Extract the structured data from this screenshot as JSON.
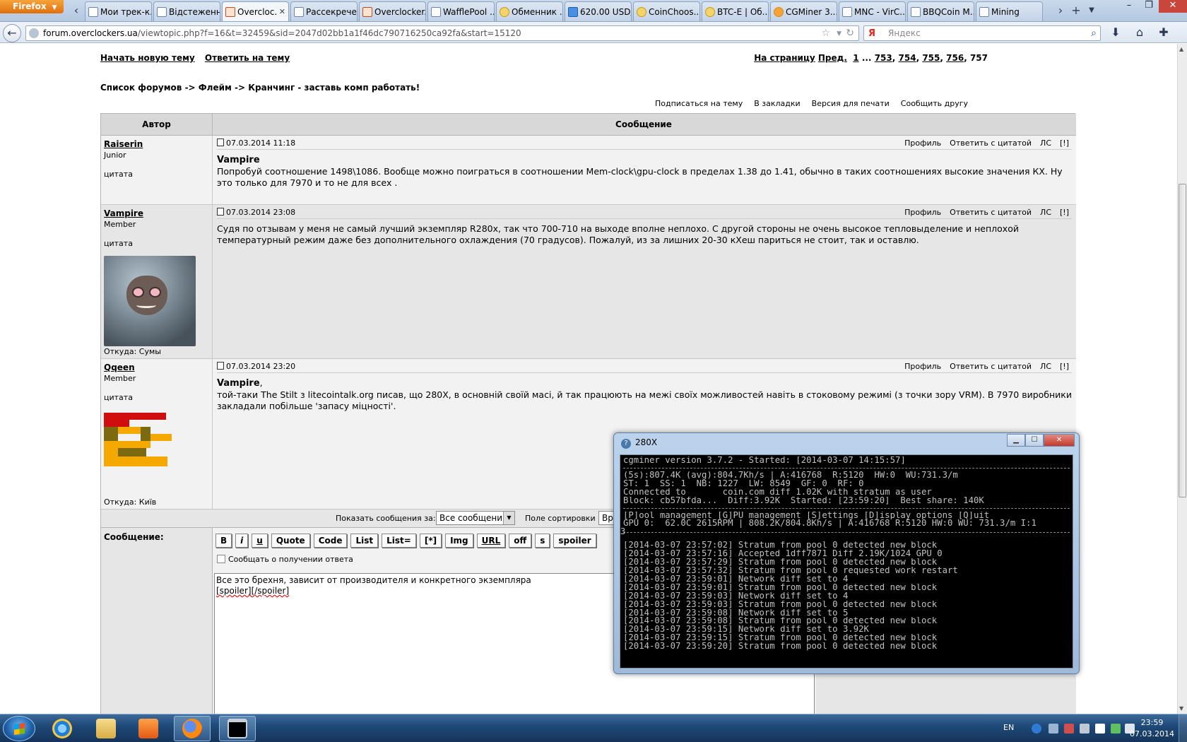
{
  "browser": {
    "menu_button": "Firefox",
    "tabs": [
      {
        "label": "Мои трек-к...",
        "icon": "generic"
      },
      {
        "label": "Відстеженн...",
        "icon": "generic"
      },
      {
        "label": "Overcloc...",
        "icon": "overclockers",
        "active": true
      },
      {
        "label": "Рассекрече...",
        "icon": "generic"
      },
      {
        "label": "Overclocker...",
        "icon": "overclockers"
      },
      {
        "label": "WafflePool ...",
        "icon": "generic"
      },
      {
        "label": "Обменник ...",
        "icon": "coin"
      },
      {
        "label": "620.00 USD/...",
        "icon": "cube"
      },
      {
        "label": "CoinChoos...",
        "icon": "coin"
      },
      {
        "label": "BTC-E | Об...",
        "icon": "coin"
      },
      {
        "label": "CGMiner 3....",
        "icon": "bitcoin"
      },
      {
        "label": "MNC - VirC...",
        "icon": "generic"
      },
      {
        "label": "BBQCoin M...",
        "icon": "generic"
      },
      {
        "label": "Mining",
        "icon": "generic"
      }
    ],
    "url_host": "forum.overclockers.ua",
    "url_prefix": "",
    "url_path": "/viewtopic.php?f=16&t=32459&sid=2047d02bb1a1f46dc790716250ca92fa&start=15120",
    "search_engine_glyph": "Я",
    "search_placeholder": "Яндекс"
  },
  "forum": {
    "new_topic": "Начать новую тему",
    "reply_topic": "Ответить на тему",
    "pagination": {
      "label": "На страницу",
      "prev": "Пред.",
      "first": "1",
      "ellipsis": "...",
      "pages": [
        "753",
        "754",
        "755",
        "756"
      ],
      "current": "757"
    },
    "breadcrumb": "Список форумов -> Флейм -> Кранчинг - заставь комп работать!",
    "top_links": [
      "Подписаться на тему",
      "В закладки",
      "Версия для печати",
      "Сообщить другу"
    ],
    "col_author": "Автор",
    "col_message": "Сообщение",
    "post_actions": [
      "Профиль",
      "Ответить с цитатой",
      "ЛС",
      "[!]"
    ],
    "posts": [
      {
        "author": "Raiserin",
        "rank": "Junior",
        "quote_label": "цитата",
        "date": "07.03.2014 11:18",
        "addressee": "Vampire",
        "text": "Попробуй соотношение 1498\\1086. Вообще можно поиграться в соотношении Mem-clock\\gpu-clock в пределах 1.38 до 1.41, обычно в таких соотношениях высокие значения КХ. Ну это только для 7970 и то не для всех ."
      },
      {
        "author": "Vampire",
        "rank": "Member",
        "quote_label": "цитата",
        "from": "Откуда: Сумы",
        "date": "07.03.2014 23:08",
        "text": "Судя по отзывам у меня не самый лучший экземпляр R280x, так что 700-710 на выходе вполне неплохо. С другой стороны не очень высокое тепловыделение и неплохой температурный режим даже без дополнительного охлаждения (70 градусов). Пожалуй, из за лишних 20-30 кХеш париться не стоит, так и оставлю."
      },
      {
        "author": "Qqeen",
        "rank": "Member",
        "quote_label": "цитата",
        "from": "Откуда: Київ",
        "date": "07.03.2014 23:20",
        "addressee": "Vampire",
        "addressee_suffix": ",",
        "text": "той-таки The Stilt з litecointalk.org писав, що 280X, в основній своїй масі, й так працюють на межі своїх можливостей навіть в стоковому режимі (з точки зору VRM). В 7970 виробники закладали побільше 'запасу міцності'."
      }
    ],
    "sort_bar": {
      "show_label": "Показать сообщения за:",
      "show_value": "Все сообщения",
      "sort_label": "Поле сортировки",
      "sort_value": "Вре"
    },
    "reply": {
      "label": "Сообщение:",
      "buttons": [
        "B",
        "i",
        "u",
        "Quote",
        "Code",
        "List",
        "List=",
        "[*]",
        "Img",
        "URL",
        "off",
        "s",
        "spoiler"
      ],
      "notify_label": "Сообщать о получении ответа",
      "line1": "Все это брехня, зависит от производителя и конкретного экземпляра",
      "line2_open": "[spoiler]",
      "line2_close": "[/spoiler]"
    }
  },
  "cgminer_window": {
    "title": "280X",
    "header": "cgminer version 3.7.2 - Started: [2014-03-07 14:15:57]",
    "stats": [
      "(5s):807.4K (avg):804.7Kh/s | A:416768  R:5120  HW:0  WU:731.3/m",
      "ST: 1  SS: 1  NB: 1227  LW: 8549  GF: 0  RF: 0",
      "Connected to       coin.com diff 1.02K with stratum as user",
      "Block: cb57bfda...  Diff:3.92K  Started: [23:59:20]  Best share: 140K"
    ],
    "menu": "[P]ool management [G]PU management [S]ettings [D]isplay options [Q]uit",
    "gpu_line": "GPU 0:  62.0C 2615RPM | 808.2K/804.8Kh/s | A:416768 R:5120 HW:0 WU: 731.3/m I:1",
    "gpu_wrap": "3",
    "log": [
      "[2014-03-07 23:57:02] Stratum from pool 0 detected new block",
      "[2014-03-07 23:57:16] Accepted 1dff7871 Diff 2.19K/1024 GPU 0",
      "[2014-03-07 23:57:29] Stratum from pool 0 detected new block",
      "[2014-03-07 23:57:32] Stratum from pool 0 requested work restart",
      "[2014-03-07 23:59:01] Network diff set to 4",
      "[2014-03-07 23:59:01] Stratum from pool 0 detected new block",
      "[2014-03-07 23:59:03] Network diff set to 4",
      "[2014-03-07 23:59:03] Stratum from pool 0 detected new block",
      "[2014-03-07 23:59:08] Network diff set to 5",
      "[2014-03-07 23:59:08] Stratum from pool 0 detected new block",
      "[2014-03-07 23:59:15] Network diff set to 3.92K",
      "[2014-03-07 23:59:15] Stratum from pool 0 detected new block",
      "[2014-03-07 23:59:20] Stratum from pool 0 detected new block"
    ]
  },
  "taskbar": {
    "language": "EN",
    "time": "23:59",
    "date": "07.03.2014"
  },
  "colors": {
    "firefox_orange": "#e0700e",
    "taskbar_blue": "#1f4a79",
    "console_bg": "#000000",
    "console_fg": "#c0c0c0"
  }
}
